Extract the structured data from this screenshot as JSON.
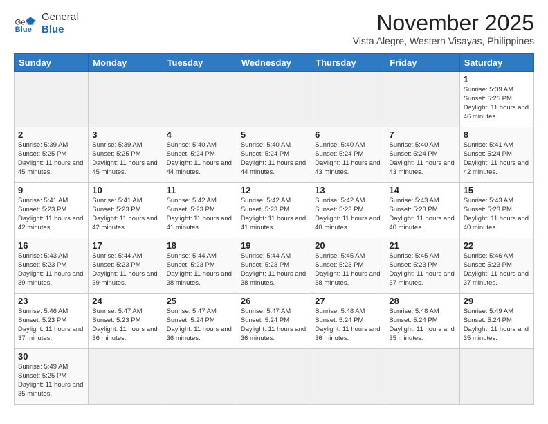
{
  "header": {
    "logo_line1": "General",
    "logo_line2": "Blue",
    "month_title": "November 2025",
    "subtitle": "Vista Alegre, Western Visayas, Philippines"
  },
  "weekdays": [
    "Sunday",
    "Monday",
    "Tuesday",
    "Wednesday",
    "Thursday",
    "Friday",
    "Saturday"
  ],
  "weeks": [
    [
      {
        "day": "",
        "info": ""
      },
      {
        "day": "",
        "info": ""
      },
      {
        "day": "",
        "info": ""
      },
      {
        "day": "",
        "info": ""
      },
      {
        "day": "",
        "info": ""
      },
      {
        "day": "",
        "info": ""
      },
      {
        "day": "1",
        "info": "Sunrise: 5:39 AM\nSunset: 5:25 PM\nDaylight: 11 hours and 46 minutes."
      }
    ],
    [
      {
        "day": "2",
        "info": "Sunrise: 5:39 AM\nSunset: 5:25 PM\nDaylight: 11 hours and 45 minutes."
      },
      {
        "day": "3",
        "info": "Sunrise: 5:39 AM\nSunset: 5:25 PM\nDaylight: 11 hours and 45 minutes."
      },
      {
        "day": "4",
        "info": "Sunrise: 5:40 AM\nSunset: 5:24 PM\nDaylight: 11 hours and 44 minutes."
      },
      {
        "day": "5",
        "info": "Sunrise: 5:40 AM\nSunset: 5:24 PM\nDaylight: 11 hours and 44 minutes."
      },
      {
        "day": "6",
        "info": "Sunrise: 5:40 AM\nSunset: 5:24 PM\nDaylight: 11 hours and 43 minutes."
      },
      {
        "day": "7",
        "info": "Sunrise: 5:40 AM\nSunset: 5:24 PM\nDaylight: 11 hours and 43 minutes."
      },
      {
        "day": "8",
        "info": "Sunrise: 5:41 AM\nSunset: 5:24 PM\nDaylight: 11 hours and 42 minutes."
      }
    ],
    [
      {
        "day": "9",
        "info": "Sunrise: 5:41 AM\nSunset: 5:23 PM\nDaylight: 11 hours and 42 minutes."
      },
      {
        "day": "10",
        "info": "Sunrise: 5:41 AM\nSunset: 5:23 PM\nDaylight: 11 hours and 42 minutes."
      },
      {
        "day": "11",
        "info": "Sunrise: 5:42 AM\nSunset: 5:23 PM\nDaylight: 11 hours and 41 minutes."
      },
      {
        "day": "12",
        "info": "Sunrise: 5:42 AM\nSunset: 5:23 PM\nDaylight: 11 hours and 41 minutes."
      },
      {
        "day": "13",
        "info": "Sunrise: 5:42 AM\nSunset: 5:23 PM\nDaylight: 11 hours and 40 minutes."
      },
      {
        "day": "14",
        "info": "Sunrise: 5:43 AM\nSunset: 5:23 PM\nDaylight: 11 hours and 40 minutes."
      },
      {
        "day": "15",
        "info": "Sunrise: 5:43 AM\nSunset: 5:23 PM\nDaylight: 11 hours and 40 minutes."
      }
    ],
    [
      {
        "day": "16",
        "info": "Sunrise: 5:43 AM\nSunset: 5:23 PM\nDaylight: 11 hours and 39 minutes."
      },
      {
        "day": "17",
        "info": "Sunrise: 5:44 AM\nSunset: 5:23 PM\nDaylight: 11 hours and 39 minutes."
      },
      {
        "day": "18",
        "info": "Sunrise: 5:44 AM\nSunset: 5:23 PM\nDaylight: 11 hours and 38 minutes."
      },
      {
        "day": "19",
        "info": "Sunrise: 5:44 AM\nSunset: 5:23 PM\nDaylight: 11 hours and 38 minutes."
      },
      {
        "day": "20",
        "info": "Sunrise: 5:45 AM\nSunset: 5:23 PM\nDaylight: 11 hours and 38 minutes."
      },
      {
        "day": "21",
        "info": "Sunrise: 5:45 AM\nSunset: 5:23 PM\nDaylight: 11 hours and 37 minutes."
      },
      {
        "day": "22",
        "info": "Sunrise: 5:46 AM\nSunset: 5:23 PM\nDaylight: 11 hours and 37 minutes."
      }
    ],
    [
      {
        "day": "23",
        "info": "Sunrise: 5:46 AM\nSunset: 5:23 PM\nDaylight: 11 hours and 37 minutes."
      },
      {
        "day": "24",
        "info": "Sunrise: 5:47 AM\nSunset: 5:23 PM\nDaylight: 11 hours and 36 minutes."
      },
      {
        "day": "25",
        "info": "Sunrise: 5:47 AM\nSunset: 5:24 PM\nDaylight: 11 hours and 36 minutes."
      },
      {
        "day": "26",
        "info": "Sunrise: 5:47 AM\nSunset: 5:24 PM\nDaylight: 11 hours and 36 minutes."
      },
      {
        "day": "27",
        "info": "Sunrise: 5:48 AM\nSunset: 5:24 PM\nDaylight: 11 hours and 36 minutes."
      },
      {
        "day": "28",
        "info": "Sunrise: 5:48 AM\nSunset: 5:24 PM\nDaylight: 11 hours and 35 minutes."
      },
      {
        "day": "29",
        "info": "Sunrise: 5:49 AM\nSunset: 5:24 PM\nDaylight: 11 hours and 35 minutes."
      }
    ],
    [
      {
        "day": "30",
        "info": "Sunrise: 5:49 AM\nSunset: 5:25 PM\nDaylight: 11 hours and 35 minutes."
      },
      {
        "day": "",
        "info": ""
      },
      {
        "day": "",
        "info": ""
      },
      {
        "day": "",
        "info": ""
      },
      {
        "day": "",
        "info": ""
      },
      {
        "day": "",
        "info": ""
      },
      {
        "day": "",
        "info": ""
      }
    ]
  ]
}
